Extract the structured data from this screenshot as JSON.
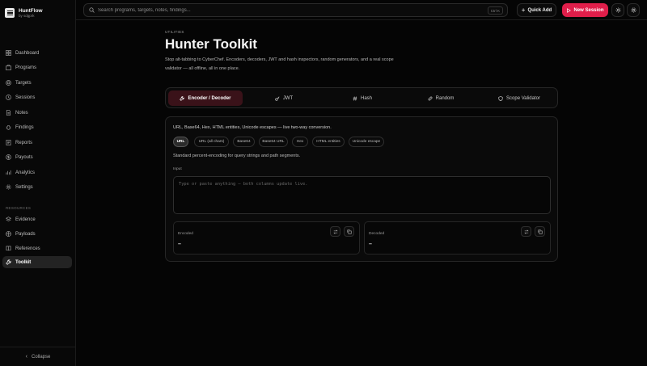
{
  "app": {
    "name": "HuntFlow",
    "byline": "by sdgprk"
  },
  "sidebar": {
    "items": [
      {
        "label": "Dashboard",
        "icon": "grid-icon"
      },
      {
        "label": "Programs",
        "icon": "briefcase-icon"
      },
      {
        "label": "Targets",
        "icon": "target-icon"
      },
      {
        "label": "Sessions",
        "icon": "clock-icon"
      },
      {
        "label": "Notes",
        "icon": "file-icon"
      },
      {
        "label": "Findings",
        "icon": "bug-icon"
      },
      {
        "label": "Reports",
        "icon": "report-icon"
      },
      {
        "label": "Payouts",
        "icon": "dollar-icon"
      },
      {
        "label": "Analytics",
        "icon": "chart-icon"
      },
      {
        "label": "Settings",
        "icon": "gear-icon"
      }
    ],
    "resources_heading": "RESOURCES",
    "resources": [
      {
        "label": "Evidence",
        "icon": "evidence-icon"
      },
      {
        "label": "Payloads",
        "icon": "payload-icon"
      },
      {
        "label": "References",
        "icon": "book-icon"
      },
      {
        "label": "Toolkit",
        "icon": "wrench-icon",
        "active": true
      }
    ],
    "collapse_label": "Collapse"
  },
  "topbar": {
    "search_placeholder": "Search programs, targets, notes, findings...",
    "search_shortcut": "Ctrl K",
    "quick_add_label": "Quick Add",
    "new_session_label": "New Session",
    "accent": "#e01e4a"
  },
  "page": {
    "eyebrow": "UTILITIES",
    "title": "Hunter Toolkit",
    "description": "Stop alt-tabbing to CyberChef. Encoders, decoders, JWT and hash inspectors, random generators, and a real scope validator — all offline, all in one place."
  },
  "tabs": [
    {
      "label": "Encoder / Decoder",
      "active": true
    },
    {
      "label": "JWT"
    },
    {
      "label": "Hash"
    },
    {
      "label": "Random"
    },
    {
      "label": "Scope Validator"
    }
  ],
  "encoder": {
    "description": "URL, Base64, Hex, HTML entities, Unicode escapes — live two-way conversion.",
    "chips": [
      "URL",
      "URL (all chars)",
      "Base64",
      "Base64 URL",
      "Hex",
      "HTML entities",
      "Unicode escape"
    ],
    "selected_chip": "URL",
    "chip_help": "Standard percent-encoding for query strings and path segments.",
    "input_label": "Input",
    "input_placeholder": "Type or paste anything — both columns update live.",
    "encoded_label": "Encoded",
    "encoded_value": "–",
    "decoded_label": "Decoded",
    "decoded_value": "–"
  }
}
